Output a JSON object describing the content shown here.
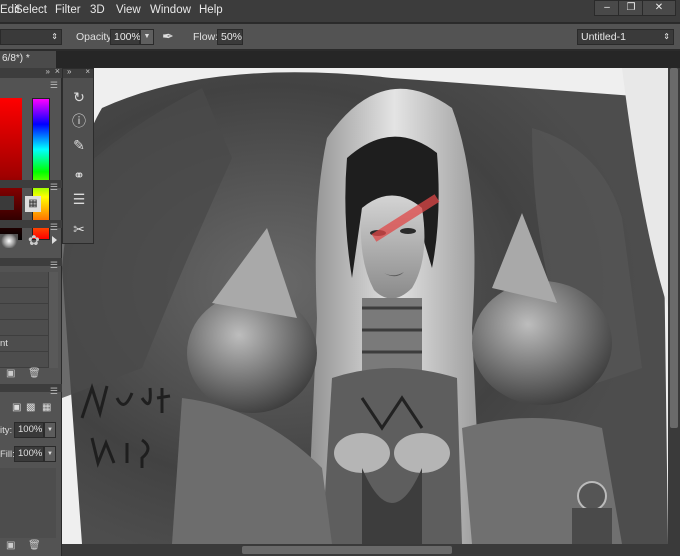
{
  "menu": {
    "items": [
      "Edit",
      "Select",
      "Filter",
      "3D",
      "View",
      "Window",
      "Help"
    ],
    "window_buttons": {
      "minimize": "–",
      "restore": "❐",
      "close": "✕"
    }
  },
  "options": {
    "left_field": "",
    "opacity_label": "Opacity:",
    "opacity_value": "100%",
    "flow_label": "Flow:",
    "flow_value": "50%",
    "document_select": "Untitled-1"
  },
  "document_tab": {
    "label": "6/8*) *"
  },
  "layers_panel": {
    "opacity_label": "ity:",
    "opacity_value": "100%",
    "fill_label": "Fill:",
    "fill_value": "100%",
    "list_rows": [
      "",
      "",
      "",
      "",
      "nt",
      ""
    ]
  },
  "tools": [
    "history-brush-icon",
    "info-icon",
    "brush-presets-icon",
    "paths-icon",
    "properties-icon",
    "tool-presets-icon"
  ],
  "colors": {
    "panel": "#535353",
    "accent_red": "#ff0000"
  }
}
